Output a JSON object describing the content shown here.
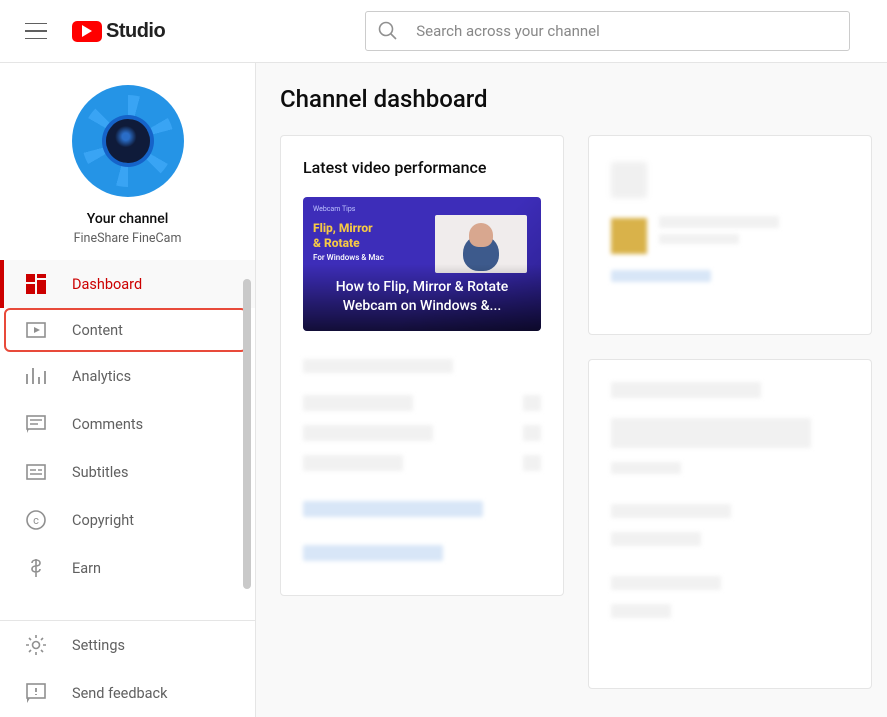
{
  "header": {
    "logo_text": "Studio",
    "search_placeholder": "Search across your channel"
  },
  "sidebar": {
    "your_channel_label": "Your channel",
    "channel_name": "FineShare FineCam",
    "items": [
      {
        "label": "Dashboard"
      },
      {
        "label": "Content"
      },
      {
        "label": "Analytics"
      },
      {
        "label": "Comments"
      },
      {
        "label": "Subtitles"
      },
      {
        "label": "Copyright"
      },
      {
        "label": "Earn"
      }
    ],
    "bottom": [
      {
        "label": "Settings"
      },
      {
        "label": "Send feedback"
      }
    ]
  },
  "main": {
    "title": "Channel dashboard",
    "latest_card_title": "Latest video performance",
    "video": {
      "tag": "Webcam Tips",
      "line1": "Flip, Mirror",
      "line2": "& Rotate",
      "line4": "For Windows & Mac",
      "overlay_line1": "How to Flip, Mirror & Rotate",
      "overlay_line2": "Webcam on Windows &..."
    }
  }
}
